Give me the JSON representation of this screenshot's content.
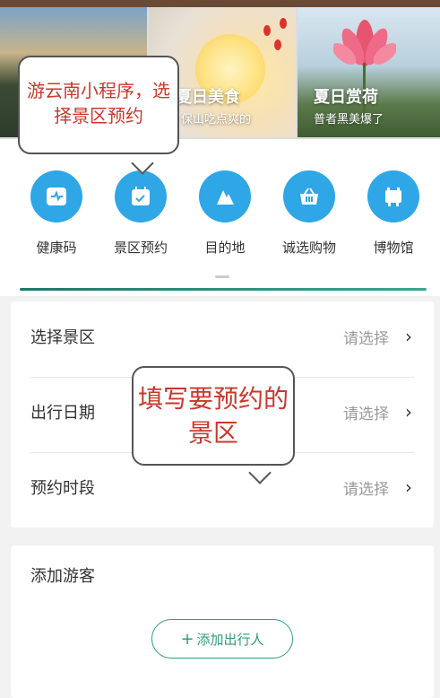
{
  "banner": {
    "cards": [
      {
        "title": "",
        "subtitle": ""
      },
      {
        "title": "夏日美食",
        "subtitle": "保山吃点爽的"
      },
      {
        "title": "夏日赏荷",
        "subtitle": "普者黑美爆了"
      }
    ]
  },
  "shortcuts": [
    {
      "label": "健康码",
      "icon": "heart-shield-icon"
    },
    {
      "label": "景区预约",
      "icon": "calendar-check-icon"
    },
    {
      "label": "目的地",
      "icon": "mountain-icon"
    },
    {
      "label": "诚选购物",
      "icon": "shopping-basket-icon"
    },
    {
      "label": "博物馆",
      "icon": "museum-icon"
    }
  ],
  "form": {
    "rows": [
      {
        "label": "选择景区",
        "value": "请选择"
      },
      {
        "label": "出行日期",
        "value": "请选择"
      },
      {
        "label": "预约时段",
        "value": "请选择"
      }
    ]
  },
  "guests": {
    "title": "添加游客",
    "add_button": "添加出行人"
  },
  "callouts": {
    "top": "游云南小程序，选择景区预约",
    "middle": "填写要预约的景区"
  },
  "colors": {
    "accent_blue": "#2fa6e6",
    "accent_green": "#2f9e76",
    "callout_text": "#c8382c"
  }
}
